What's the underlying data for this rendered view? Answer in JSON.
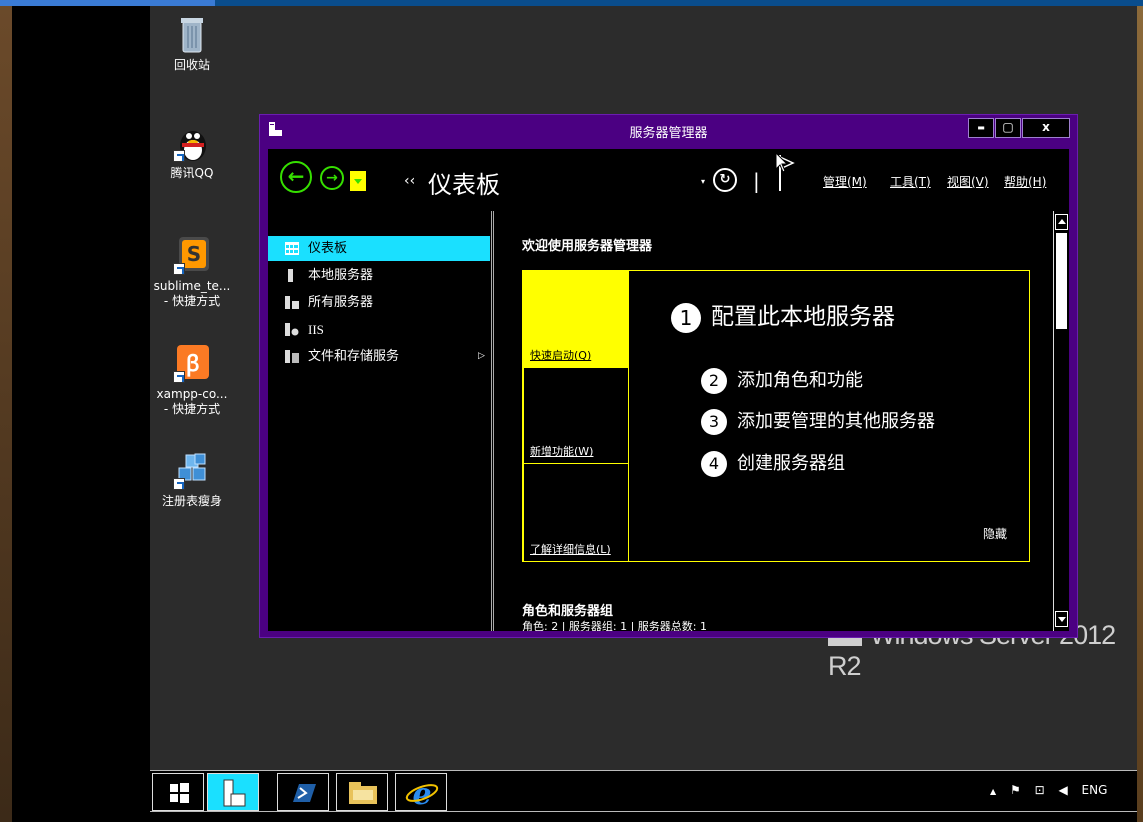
{
  "desktop": {
    "icons": [
      {
        "label": "回收站"
      },
      {
        "label": "腾讯QQ"
      },
      {
        "label": "sublime_te...\n- 快捷方式"
      },
      {
        "label": "xampp-co...\n- 快捷方式"
      },
      {
        "label": "注册表瘦身"
      }
    ],
    "watermark": "Windows Server 2012 R2"
  },
  "window": {
    "title": "服务器管理器",
    "controls": {
      "minimize": "▬",
      "maximize": "▢",
      "close": "x"
    },
    "breadcrumb_prefix": "‹‹",
    "breadcrumb": "仪表板",
    "refresh_dropdown": "▾",
    "separator": "|",
    "menu": [
      "管理(M)",
      "工具(T)",
      "视图(V)",
      "帮助(H)"
    ]
  },
  "nav": {
    "items": [
      {
        "label": "仪表板",
        "icon": "dashboard-icon",
        "selected": true
      },
      {
        "label": "本地服务器",
        "icon": "server-icon"
      },
      {
        "label": "所有服务器",
        "icon": "servers-icon"
      },
      {
        "label": "IIS",
        "icon": "iis-icon"
      },
      {
        "label": "文件和存储服务",
        "icon": "storage-icon",
        "chevron": "▷"
      }
    ]
  },
  "welcome": {
    "title": "欢迎使用服务器管理器",
    "tiles": [
      "快速启动(Q)",
      "新增功能(W)",
      "了解详细信息(L)"
    ],
    "steps": [
      {
        "num": "1",
        "label": "配置此本地服务器"
      },
      {
        "num": "2",
        "label": "添加角色和功能"
      },
      {
        "num": "3",
        "label": "添加要管理的其他服务器"
      },
      {
        "num": "4",
        "label": "创建服务器组"
      }
    ],
    "hide": "隐藏"
  },
  "roles": {
    "title": "角色和服务器组",
    "summary": "角色: 2 | 服务器组: 1 | 服务器总数: 1"
  },
  "taskbar": {
    "tray": {
      "up": "▲",
      "lang": "ENG"
    }
  },
  "colors": {
    "window_frame": "#4b0082",
    "selection": "#1ae0ff",
    "accent_yellow": "#ffff00",
    "nav_green": "#36e000"
  }
}
